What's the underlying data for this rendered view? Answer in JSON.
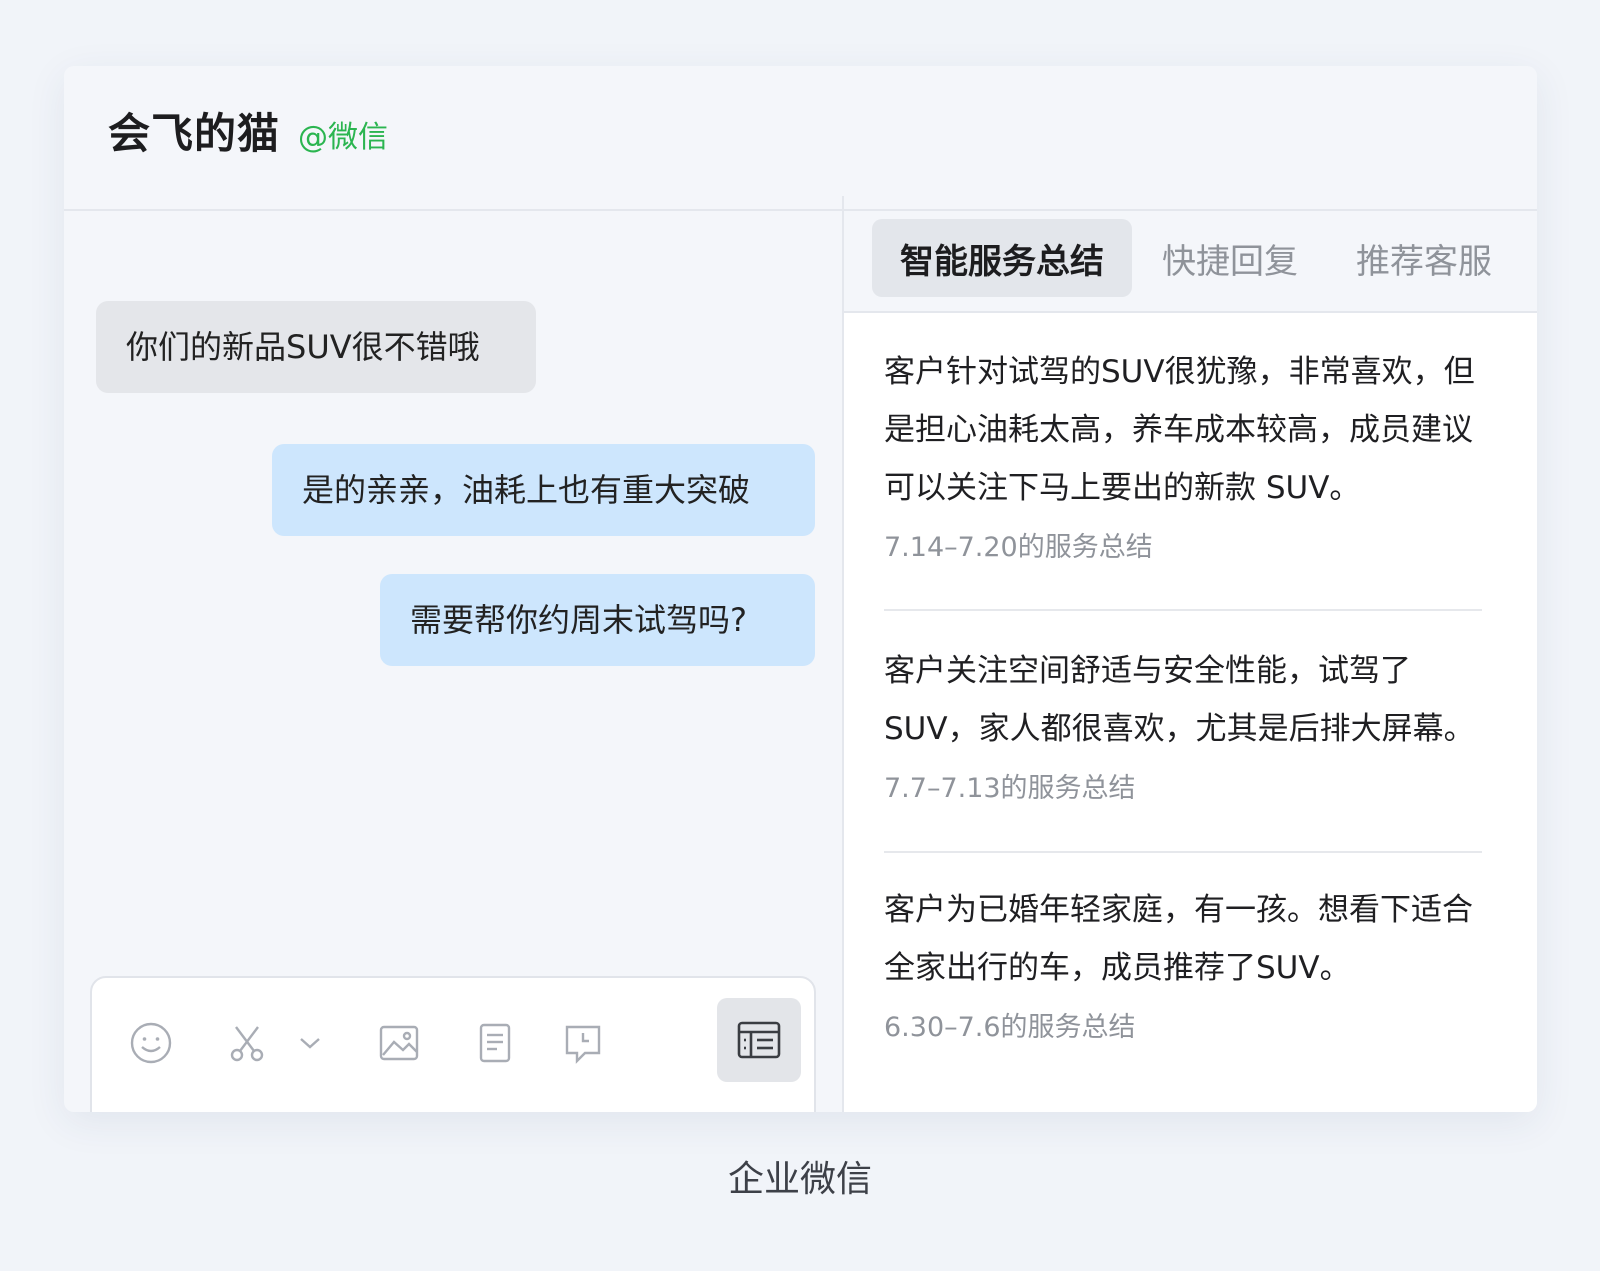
{
  "header": {
    "contact_name": "会飞的猫",
    "contact_source": "@微信"
  },
  "chat": {
    "messages": [
      {
        "direction": "in",
        "text": "你们的新品SUV很不错哦"
      },
      {
        "direction": "out",
        "text": "是的亲亲，油耗上也有重大突破"
      },
      {
        "direction": "out",
        "text": "需要帮你约周末试驾吗?"
      }
    ]
  },
  "composer": {
    "tools": [
      "emoji-icon",
      "scissors-icon",
      "chevron-down-icon",
      "image-icon",
      "file-icon",
      "chat-history-icon",
      "summary-icon"
    ]
  },
  "sidebar": {
    "tabs": [
      {
        "label": "智能服务总结",
        "active": true
      },
      {
        "label": "快捷回复",
        "active": false
      },
      {
        "label": "推荐客服",
        "active": false
      }
    ],
    "summaries": [
      {
        "text": "客户针对试驾的SUV很犹豫，非常喜欢，但是担心油耗太高，养车成本较高，成员建议可以关注下马上要出的新款 SUV。",
        "period": "7.14–7.20的服务总结"
      },
      {
        "text": "客户关注空间舒适与安全性能，试驾了SUV，家人都很喜欢，尤其是后排大屏幕。",
        "period": "7.7–7.13的服务总结"
      },
      {
        "text": "客户为已婚年轻家庭，有一孩。想看下适合全家出行的车，成员推荐了SUV。",
        "period": "6.30–7.6的服务总结"
      }
    ]
  },
  "caption": "企业微信",
  "colors": {
    "page_bg": "#f1f4f9",
    "source_green": "#2bb550",
    "outgoing_bubble": "#cde6fd",
    "incoming_bubble": "#e4e6ea"
  }
}
